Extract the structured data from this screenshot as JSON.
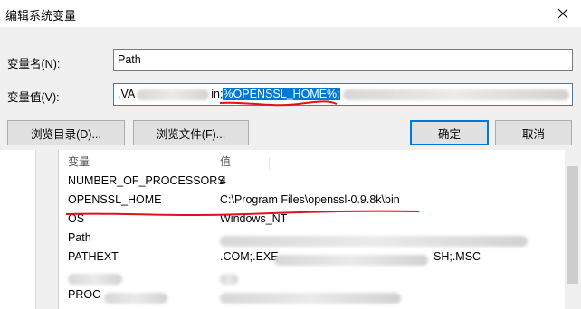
{
  "dialog": {
    "title": "编辑系统变量",
    "name_label": "变量名(N):",
    "name_value": "Path",
    "value_label": "变量值(V):",
    "value_prefix": ".VA",
    "value_mid": "in;",
    "value_selected": "%OPENSSL_HOME%",
    "value_after": ";",
    "browse_dir_label": "浏览目录(D)...",
    "browse_file_label": "浏览文件(F)...",
    "ok_label": "确定",
    "cancel_label": "取消"
  },
  "list": {
    "headers": [
      "变量",
      "值"
    ],
    "rows": [
      {
        "name": "NUMBER_OF_PROCESSORS",
        "value": "4"
      },
      {
        "name": "OPENSSL_HOME",
        "value": "C:\\Program Files\\openssl-0.9.8k\\bin"
      },
      {
        "name": "OS",
        "value": "Windows_NT"
      },
      {
        "name": "Path",
        "value": ""
      },
      {
        "name": "PATHEXT",
        "value": ".COM;.EXE",
        "value_tail": "SH;.MSC"
      },
      {
        "name": "",
        "value": ""
      },
      {
        "name": "PROC",
        "value": ""
      }
    ]
  }
}
